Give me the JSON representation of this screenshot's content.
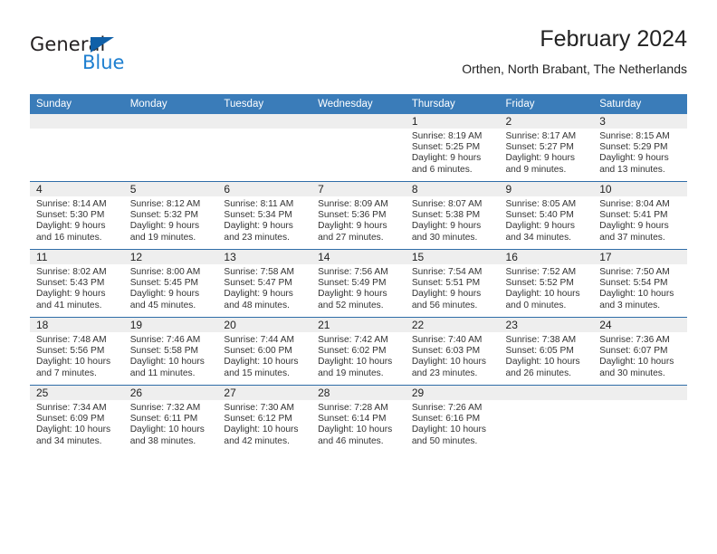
{
  "logo": {
    "word_top": "General",
    "word_bottom": "Blue",
    "triangle_color": "#1060a8",
    "blue_color": "#1e7fd0"
  },
  "header": {
    "title": "February 2024",
    "subtitle": "Orthen, North Brabant, The Netherlands"
  },
  "theme": {
    "header_bg": "#3a7cb9",
    "row_divider": "#2f6da8",
    "daynum_bg": "#eeeeee"
  },
  "calendar": {
    "weekday_headers": [
      "Sunday",
      "Monday",
      "Tuesday",
      "Wednesday",
      "Thursday",
      "Friday",
      "Saturday"
    ],
    "weeks": [
      [
        {
          "day": "",
          "lines": []
        },
        {
          "day": "",
          "lines": []
        },
        {
          "day": "",
          "lines": []
        },
        {
          "day": "",
          "lines": []
        },
        {
          "day": "1",
          "lines": [
            "Sunrise: 8:19 AM",
            "Sunset: 5:25 PM",
            "Daylight: 9 hours",
            "and 6 minutes."
          ]
        },
        {
          "day": "2",
          "lines": [
            "Sunrise: 8:17 AM",
            "Sunset: 5:27 PM",
            "Daylight: 9 hours",
            "and 9 minutes."
          ]
        },
        {
          "day": "3",
          "lines": [
            "Sunrise: 8:15 AM",
            "Sunset: 5:29 PM",
            "Daylight: 9 hours",
            "and 13 minutes."
          ]
        }
      ],
      [
        {
          "day": "4",
          "lines": [
            "Sunrise: 8:14 AM",
            "Sunset: 5:30 PM",
            "Daylight: 9 hours",
            "and 16 minutes."
          ]
        },
        {
          "day": "5",
          "lines": [
            "Sunrise: 8:12 AM",
            "Sunset: 5:32 PM",
            "Daylight: 9 hours",
            "and 19 minutes."
          ]
        },
        {
          "day": "6",
          "lines": [
            "Sunrise: 8:11 AM",
            "Sunset: 5:34 PM",
            "Daylight: 9 hours",
            "and 23 minutes."
          ]
        },
        {
          "day": "7",
          "lines": [
            "Sunrise: 8:09 AM",
            "Sunset: 5:36 PM",
            "Daylight: 9 hours",
            "and 27 minutes."
          ]
        },
        {
          "day": "8",
          "lines": [
            "Sunrise: 8:07 AM",
            "Sunset: 5:38 PM",
            "Daylight: 9 hours",
            "and 30 minutes."
          ]
        },
        {
          "day": "9",
          "lines": [
            "Sunrise: 8:05 AM",
            "Sunset: 5:40 PM",
            "Daylight: 9 hours",
            "and 34 minutes."
          ]
        },
        {
          "day": "10",
          "lines": [
            "Sunrise: 8:04 AM",
            "Sunset: 5:41 PM",
            "Daylight: 9 hours",
            "and 37 minutes."
          ]
        }
      ],
      [
        {
          "day": "11",
          "lines": [
            "Sunrise: 8:02 AM",
            "Sunset: 5:43 PM",
            "Daylight: 9 hours",
            "and 41 minutes."
          ]
        },
        {
          "day": "12",
          "lines": [
            "Sunrise: 8:00 AM",
            "Sunset: 5:45 PM",
            "Daylight: 9 hours",
            "and 45 minutes."
          ]
        },
        {
          "day": "13",
          "lines": [
            "Sunrise: 7:58 AM",
            "Sunset: 5:47 PM",
            "Daylight: 9 hours",
            "and 48 minutes."
          ]
        },
        {
          "day": "14",
          "lines": [
            "Sunrise: 7:56 AM",
            "Sunset: 5:49 PM",
            "Daylight: 9 hours",
            "and 52 minutes."
          ]
        },
        {
          "day": "15",
          "lines": [
            "Sunrise: 7:54 AM",
            "Sunset: 5:51 PM",
            "Daylight: 9 hours",
            "and 56 minutes."
          ]
        },
        {
          "day": "16",
          "lines": [
            "Sunrise: 7:52 AM",
            "Sunset: 5:52 PM",
            "Daylight: 10 hours",
            "and 0 minutes."
          ]
        },
        {
          "day": "17",
          "lines": [
            "Sunrise: 7:50 AM",
            "Sunset: 5:54 PM",
            "Daylight: 10 hours",
            "and 3 minutes."
          ]
        }
      ],
      [
        {
          "day": "18",
          "lines": [
            "Sunrise: 7:48 AM",
            "Sunset: 5:56 PM",
            "Daylight: 10 hours",
            "and 7 minutes."
          ]
        },
        {
          "day": "19",
          "lines": [
            "Sunrise: 7:46 AM",
            "Sunset: 5:58 PM",
            "Daylight: 10 hours",
            "and 11 minutes."
          ]
        },
        {
          "day": "20",
          "lines": [
            "Sunrise: 7:44 AM",
            "Sunset: 6:00 PM",
            "Daylight: 10 hours",
            "and 15 minutes."
          ]
        },
        {
          "day": "21",
          "lines": [
            "Sunrise: 7:42 AM",
            "Sunset: 6:02 PM",
            "Daylight: 10 hours",
            "and 19 minutes."
          ]
        },
        {
          "day": "22",
          "lines": [
            "Sunrise: 7:40 AM",
            "Sunset: 6:03 PM",
            "Daylight: 10 hours",
            "and 23 minutes."
          ]
        },
        {
          "day": "23",
          "lines": [
            "Sunrise: 7:38 AM",
            "Sunset: 6:05 PM",
            "Daylight: 10 hours",
            "and 26 minutes."
          ]
        },
        {
          "day": "24",
          "lines": [
            "Sunrise: 7:36 AM",
            "Sunset: 6:07 PM",
            "Daylight: 10 hours",
            "and 30 minutes."
          ]
        }
      ],
      [
        {
          "day": "25",
          "lines": [
            "Sunrise: 7:34 AM",
            "Sunset: 6:09 PM",
            "Daylight: 10 hours",
            "and 34 minutes."
          ]
        },
        {
          "day": "26",
          "lines": [
            "Sunrise: 7:32 AM",
            "Sunset: 6:11 PM",
            "Daylight: 10 hours",
            "and 38 minutes."
          ]
        },
        {
          "day": "27",
          "lines": [
            "Sunrise: 7:30 AM",
            "Sunset: 6:12 PM",
            "Daylight: 10 hours",
            "and 42 minutes."
          ]
        },
        {
          "day": "28",
          "lines": [
            "Sunrise: 7:28 AM",
            "Sunset: 6:14 PM",
            "Daylight: 10 hours",
            "and 46 minutes."
          ]
        },
        {
          "day": "29",
          "lines": [
            "Sunrise: 7:26 AM",
            "Sunset: 6:16 PM",
            "Daylight: 10 hours",
            "and 50 minutes."
          ]
        },
        {
          "day": "",
          "lines": []
        },
        {
          "day": "",
          "lines": []
        }
      ]
    ]
  }
}
